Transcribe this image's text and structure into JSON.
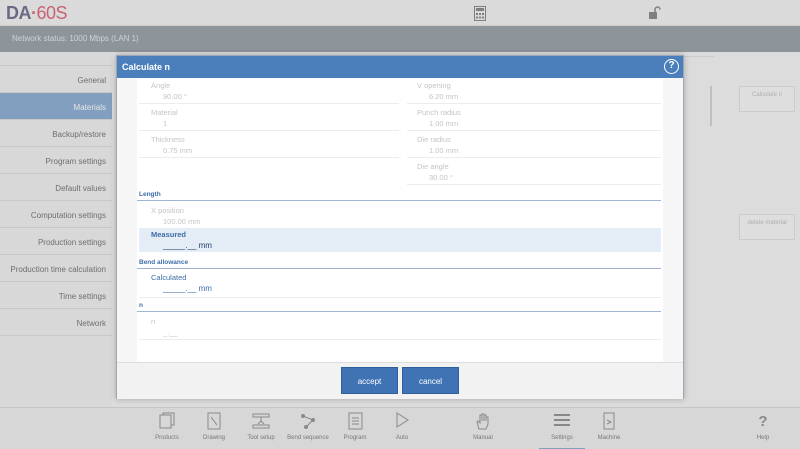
{
  "app": {
    "logo_main": "DA",
    "logo_sep": "·",
    "logo_model": "60S"
  },
  "topbar": {
    "icons": [
      "calculator-icon",
      "lock-icon"
    ]
  },
  "status": {
    "text": "Network status: 1000 Mbps (LAN 1)"
  },
  "sidebar": {
    "items": [
      {
        "label": "General"
      },
      {
        "label": "Materials"
      },
      {
        "label": "Backup/restore"
      },
      {
        "label": "Program settings"
      },
      {
        "label": "Default values"
      },
      {
        "label": "Computation settings"
      },
      {
        "label": "Production settings"
      },
      {
        "label": "Production time calculation"
      },
      {
        "label": "Time settings"
      },
      {
        "label": "Network"
      }
    ],
    "active": "Materials"
  },
  "background": {
    "btn1": "Calculate n",
    "btn2": "delete material"
  },
  "dialog": {
    "title": "Calculate n",
    "help": "?",
    "angle": {
      "label": "Angle",
      "value": "90.00 °"
    },
    "material": {
      "label": "Material",
      "value": "1"
    },
    "thickness": {
      "label": "Thickness",
      "value": "0.75 mm"
    },
    "v_opening": {
      "label": "V opening",
      "value": "6.20 mm"
    },
    "punch_radius": {
      "label": "Punch radius",
      "value": "1.00 mm"
    },
    "die_radius": {
      "label": "Die radius",
      "value": "1.00 mm"
    },
    "die_angle": {
      "label": "Die angle",
      "value": "30.00 °"
    },
    "length_section": "Length",
    "x_position": {
      "label": "X position",
      "value": "100.00 mm"
    },
    "measured": {
      "label": "Measured",
      "value": "_____.__ mm"
    },
    "bend_section": "Bend allowance",
    "calculated": {
      "label": "Calculated",
      "value": "_____.__ mm"
    },
    "n_section": "n",
    "n_field": {
      "label": "n",
      "value": "_.__"
    },
    "accept": "accept",
    "cancel": "cancel"
  },
  "bottomnav": {
    "items": [
      {
        "label": "Products",
        "icon": "products-icon"
      },
      {
        "label": "Drawing",
        "icon": "drawing-icon"
      },
      {
        "label": "Tool setup",
        "icon": "tool-setup-icon"
      },
      {
        "label": "Bend sequence",
        "icon": "bend-sequence-icon"
      },
      {
        "label": "Program",
        "icon": "program-icon"
      },
      {
        "label": "Auto",
        "icon": "play-icon"
      },
      {
        "label": "Manual",
        "icon": "hand-icon"
      },
      {
        "label": "Settings",
        "icon": "settings-icon"
      },
      {
        "label": "Machine",
        "icon": "machine-icon"
      },
      {
        "label": "Help",
        "icon": "help-icon"
      }
    ],
    "active": "Settings"
  }
}
